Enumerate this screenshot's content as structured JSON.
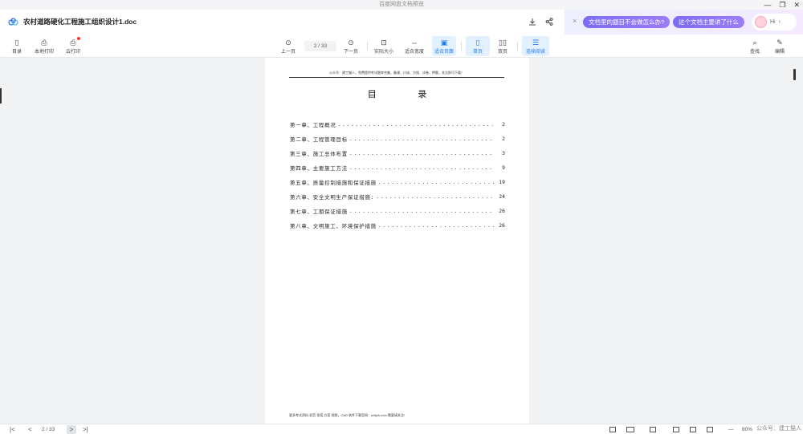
{
  "window": {
    "title": "百度网盘文档预览",
    "controls": [
      "—",
      "❐",
      "✕"
    ]
  },
  "header": {
    "doc_title": "农村道路硬化工程施工组织设计1.doc",
    "download_icon": "download-icon",
    "share_icon": "share-icon"
  },
  "ai_panel": {
    "chip1": "文档里的题目不会做怎么办?",
    "chip2": "这个文档主要讲了什么",
    "greeting": "Hi"
  },
  "toolbar": {
    "catalog": "目录",
    "local_print": "本地打印",
    "cloud_print": "云打印",
    "prev_page": "上一页",
    "page_indicator": "2 / 33",
    "next_page": "下一页",
    "actual_size": "实际大小",
    "fit_width": "适合宽度",
    "fit_page": "适合页面",
    "single_page": "单页",
    "double_page": "双页",
    "continuous": "连续阅读",
    "search": "查找",
    "edit": "编辑"
  },
  "document": {
    "header_text": "公众号：建工猫人，免费提供考试题库合集、备课、口诀、方程、试卷、押题，关注即可下载！",
    "toc_title": "目 录",
    "toc": [
      {
        "title": "第一章、工程概况",
        "page": "2"
      },
      {
        "title": "第二章、工程管理目标",
        "page": "2"
      },
      {
        "title": "第三章、施工总体布置",
        "page": "3"
      },
      {
        "title": "第四章、主要施工方法",
        "page": "9"
      },
      {
        "title": "第五章、质量控制措施和保证措施",
        "page": "19"
      },
      {
        "title": "第六章、安全文明生产保证措施:",
        "page": "24"
      },
      {
        "title": "第七章、工期保证措施",
        "page": "26"
      },
      {
        "title": "第八章、文明施工、环境保护措施",
        "page": "26"
      }
    ],
    "footer_text": "更多考试资料 初范 答案 方案 视频，CAD 软件下载官网：sxhjck.com 需要请关注!"
  },
  "statusbar": {
    "first": "|<",
    "prev": "<",
    "page_indicator": "2 / 33",
    "next": ">",
    "last": ">|",
    "zoom_minus": "—",
    "zoom": "80%",
    "zoom_plus": "+",
    "watermark": "公众号：建工猫人"
  }
}
